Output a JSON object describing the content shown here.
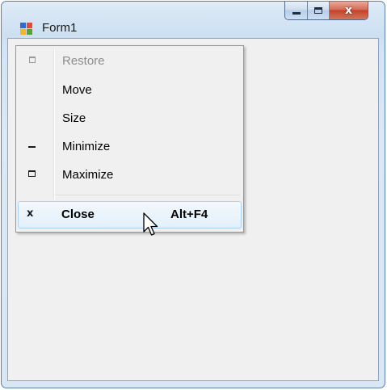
{
  "window": {
    "title": "Form1",
    "icon": "windows-form-icon",
    "caption_buttons": [
      "minimize-icon",
      "maximize-icon",
      "close-icon"
    ],
    "close_glyph": "x"
  },
  "system_menu": {
    "items": [
      {
        "label": "Restore",
        "icon": "restore-icon",
        "enabled": false
      },
      {
        "label": "Move",
        "enabled": true
      },
      {
        "label": "Size",
        "enabled": true
      },
      {
        "label": "Minimize",
        "icon": "minimize-icon",
        "enabled": true
      },
      {
        "label": "Maximize",
        "icon": "maximize-icon",
        "enabled": true
      },
      {
        "label": "Close",
        "icon": "close-icon",
        "glyph": "x",
        "shortcut": "Alt+F4",
        "enabled": true,
        "highlighted": true
      }
    ]
  },
  "colors": {
    "titlebar": "#c9dcf0",
    "close_button": "#c9452d",
    "menu_highlight": "#e3f0fb",
    "menu_highlight_border": "#a8d1f2",
    "disabled_text": "#8d8d8d"
  }
}
